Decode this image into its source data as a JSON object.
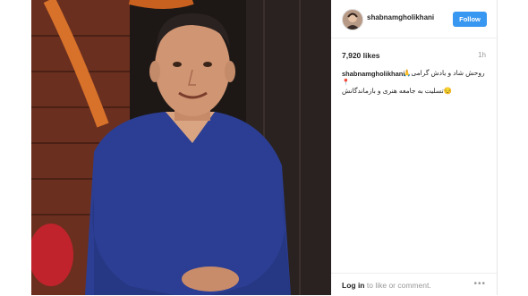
{
  "post": {
    "username": "shabnamgholikhani",
    "follow_label": "Follow",
    "likes": "7,920 likes",
    "time": "1h",
    "caption_line1": "روحش شاد و یادش گرامی",
    "caption_line1_emoji": "🙏",
    "caption_line2": "تسلیت به جامعه هنری و بازماندگانش",
    "caption_line2_emoji": "😔",
    "pin_glyph": "📍",
    "footer_login": "Log in",
    "footer_rest": "to like or comment.",
    "more_icon": "•••"
  },
  "colors": {
    "follow_bg": "#3897f0",
    "shirt": "#2a3f8f",
    "wall": "#7a3a25"
  }
}
